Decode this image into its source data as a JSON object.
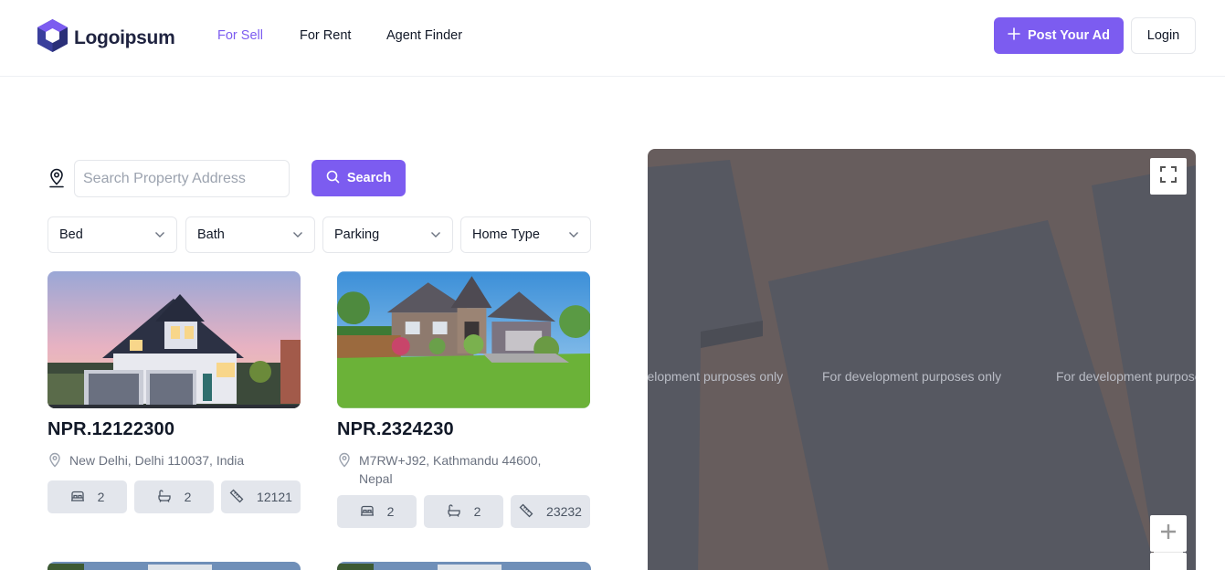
{
  "header": {
    "logo_text": "Logoipsum",
    "nav": [
      {
        "label": "For Sell",
        "active": true
      },
      {
        "label": "For Rent",
        "active": false
      },
      {
        "label": "Agent Finder",
        "active": false
      }
    ],
    "post_ad_label": "Post Your Ad",
    "login_label": "Login"
  },
  "search": {
    "placeholder": "Search Property Address",
    "value": "",
    "button_label": "Search"
  },
  "filters": [
    {
      "label": "Bed"
    },
    {
      "label": "Bath"
    },
    {
      "label": "Parking"
    },
    {
      "label": "Home Type"
    }
  ],
  "listings": [
    {
      "price": "NPR.12122300",
      "address": "New Delhi, Delhi 110037, India",
      "beds": "2",
      "baths": "2",
      "area": "12121"
    },
    {
      "price": "NPR.2324230",
      "address": "M7RW+J92, Kathmandu 44600, Nepal",
      "beds": "2",
      "baths": "2",
      "area": "23232"
    }
  ],
  "map": {
    "watermark": "For development purposes only"
  },
  "colors": {
    "accent": "#7c5cf0",
    "chip_bg": "#e3e6ec",
    "map_ground": "#675d5d",
    "map_block": "#565861"
  }
}
